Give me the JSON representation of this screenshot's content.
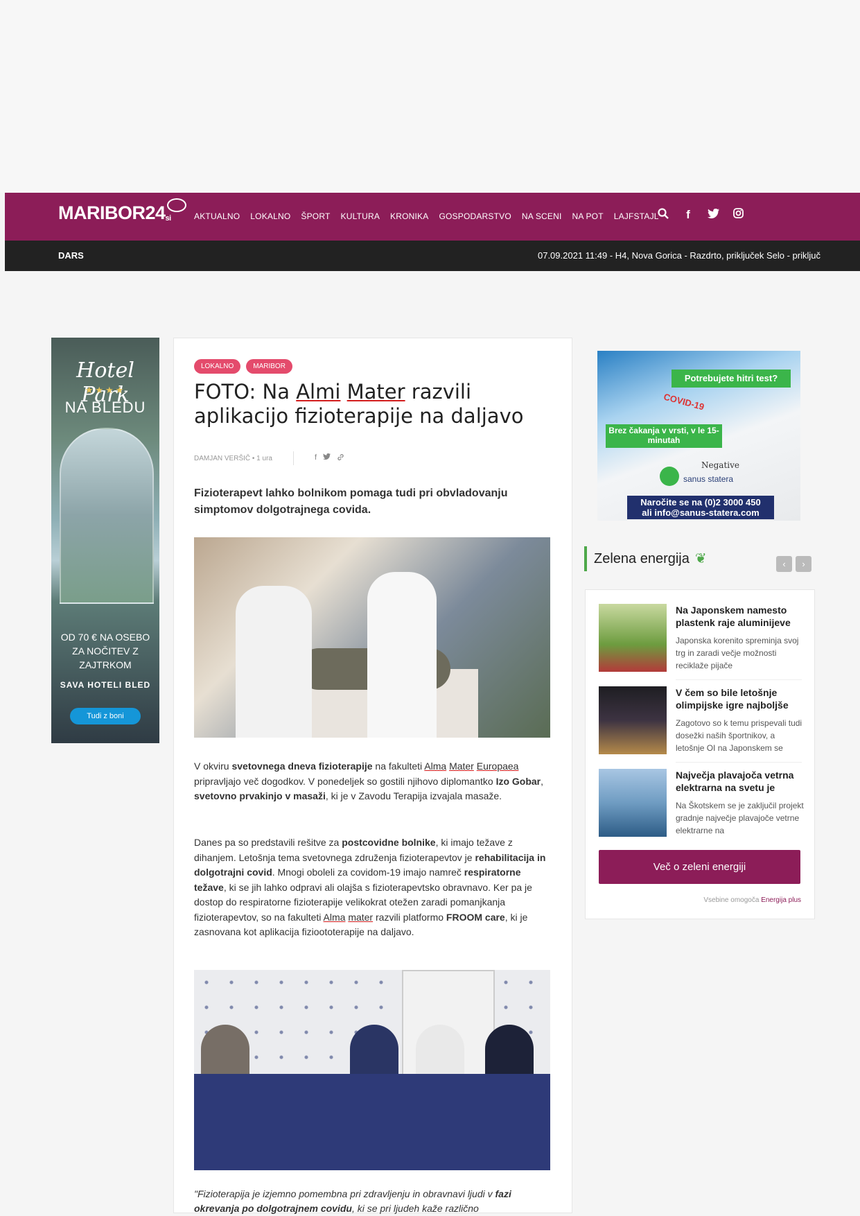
{
  "header": {
    "logo": "MARIBOR24",
    "logo_suffix": "si",
    "nav": [
      "AKTUALNO",
      "LOKALNO",
      "ŠPORT",
      "KULTURA",
      "KRONIKA",
      "GOSPODARSTVO",
      "NA SCENI",
      "NA POT",
      "LAJFSTAJL"
    ],
    "icons": [
      "search-icon",
      "facebook-icon",
      "twitter-icon",
      "instagram-icon"
    ],
    "brand_color": "#8c1d58"
  },
  "ticker": {
    "label": "DARS",
    "text": "07.09.2021 11:49 - H4, Nova Gorica - Razdrto, priključek Selo - priključ"
  },
  "left_ad": {
    "title": "Hotel Park",
    "stars": "★★★★",
    "location": "NA BLEDU",
    "price_l1": "OD 70 € NA OSEBO",
    "price_l2": "ZA NOČITEV Z",
    "price_l3": "ZAJTRKOM",
    "brand": "SAVA HOTELI BLED",
    "button": "Tudi z boni"
  },
  "article": {
    "tags": [
      "LOKALNO",
      "MARIBOR"
    ],
    "title_p1": "FOTO: Na ",
    "title_u1": "Almi",
    "title_p2": " ",
    "title_u2": "Mater",
    "title_p3": " razvili aplikacijo fizioterapije na daljavo",
    "author": "DAMJAN VERŠIČ • 1 ura",
    "lead": "Fizioterapevt lahko bolnikom pomaga tudi pri obvladovanju simptomov dolgotrajnega covida.",
    "para1": {
      "a": "V okviru ",
      "b": "svetovnega dneva fizioterapije",
      "c": " na fakulteti ",
      "d": "Alma",
      "e": " ",
      "f": "Mater",
      "g": " ",
      "h": "Europaea",
      "i": " pripravljajo več dogodkov. V ponedeljek so gostili njihovo diplomantko ",
      "j": "Izo Gobar",
      "k": ", ",
      "l": "svetovno prvakinjo v masaži",
      "m": ", ki je v Zavodu Terapija izvajala masaže."
    },
    "para2": {
      "a": "Danes pa so predstavili rešitve za ",
      "b": "postcovidne bolnike",
      "c": ", ki imajo težave z dihanjem. Letošnja tema svetovnega združenja fizioterapevtov je ",
      "d": "rehabilitacija in dolgotrajni covid",
      "e": ". Mnogi oboleli za covidom-19 imajo namreč ",
      "f": "respiratorne težave",
      "g": ", ki se jih lahko odpravi ali olajša s fizioterapevtsko obravnavo. Ker pa je dostop do respiratorne fizioterapije velikokrat otežen zaradi pomanjkanja fizioterapevtov, so na fakulteti ",
      "h": "Alma",
      "i": " ",
      "j": "mater",
      "k": " razvili platformo ",
      "l": "FROOM care",
      "m": ", ki je zasnovana kot aplikacija fizioototerapije na daljavo."
    },
    "quote_a": "\"Fizioterapija je izjemno pomembna pri zdravljenju in obravnavi ljudi v ",
    "quote_b": "fazi okrevanja po dolgotrajnem covidu",
    "quote_c": ", ki se pri ljudeh kaže različno"
  },
  "right_ad": {
    "line1": "Potrebujete hitri test?",
    "covid": "COVID-19",
    "line2": "Brez čakanja v vrsti, v le 15-minutah",
    "negative": "Negative",
    "brand": "sanus statera",
    "contact_l1": "Naročite se na (0)2 3000 450",
    "contact_l2": "ali info@sanus-statera.com"
  },
  "energy": {
    "heading": "Zelena energija",
    "items": [
      {
        "title": "Na Japonskem namesto plastenk raje aluminijeve",
        "desc": "Japonska korenito spreminja svoj trg in zaradi večje možnosti reciklaže pijače"
      },
      {
        "title": "V čem so bile letošnje olimpijske igre najboljše",
        "desc": "Zagotovo so k temu prispevali tudi dosežki naših športnikov, a letošnje OI na Japonskem se"
      },
      {
        "title": "Največja plavajoča vetrna elektrarna na svetu je",
        "desc": "Na Škotskem se je zaključil projekt gradnje največje plavajoče vetrne elektrarne na"
      }
    ],
    "button": "Več o zeleni energiji",
    "credit_prefix": "Vsebine omogoča ",
    "credit_link": "Energija plus"
  }
}
